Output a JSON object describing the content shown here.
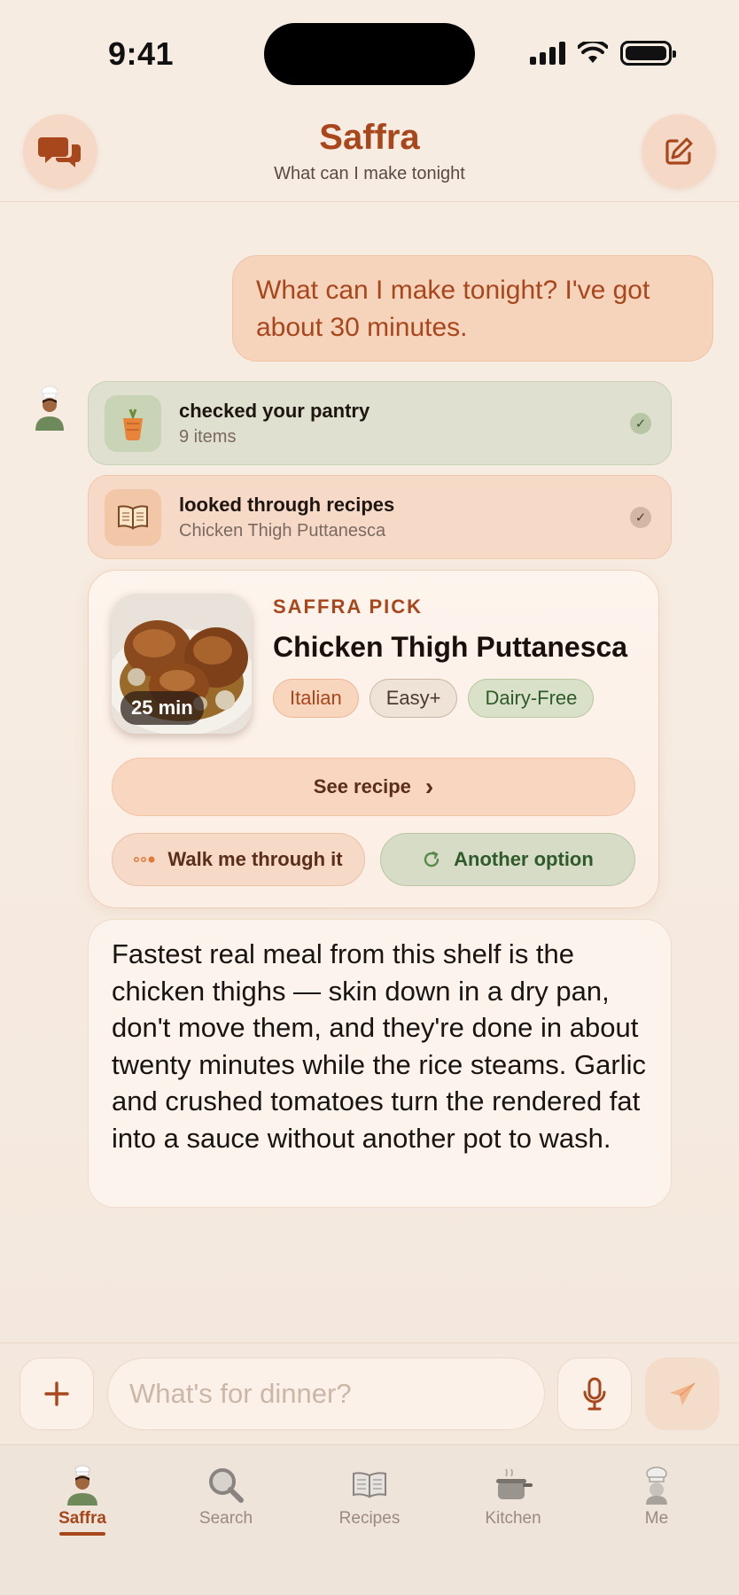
{
  "status": {
    "time": "9:41"
  },
  "header": {
    "title": "Saffra",
    "subtitle": "What can I make tonight"
  },
  "user_message": "What can I make tonight? I've got about 30 minutes.",
  "steps": [
    {
      "title": "checked your pantry",
      "subtitle": "9 items",
      "icon": "carrot-basket-icon"
    },
    {
      "title": "looked through recipes",
      "subtitle": "Chicken Thigh Puttanesca",
      "icon": "open-book-icon"
    }
  ],
  "recipe_card": {
    "pick_label": "SAFFRA PICK",
    "title": "Chicken Thigh Puttanesca",
    "time": "25 min",
    "tags": [
      "Italian",
      "Easy+",
      "Dairy-Free"
    ],
    "see_recipe": "See recipe",
    "walk_through": "Walk me through it",
    "another_option": "Another option"
  },
  "assistant_message": "Fastest real meal from this shelf is the chicken thighs — skin down in a dry pan, don't move them, and they're done in about twenty minutes while the rice steams. Garlic and crushed tomatoes turn the rendered fat into a sauce without another pot to wash.",
  "composer": {
    "placeholder": "What's for dinner?"
  },
  "tabs": [
    {
      "label": "Saffra",
      "active": true
    },
    {
      "label": "Search",
      "active": false
    },
    {
      "label": "Recipes",
      "active": false
    },
    {
      "label": "Kitchen",
      "active": false
    },
    {
      "label": "Me",
      "active": false
    }
  ],
  "colors": {
    "accent": "#a8461c",
    "background": "#f6ece2",
    "green": "#2f5a2a"
  }
}
